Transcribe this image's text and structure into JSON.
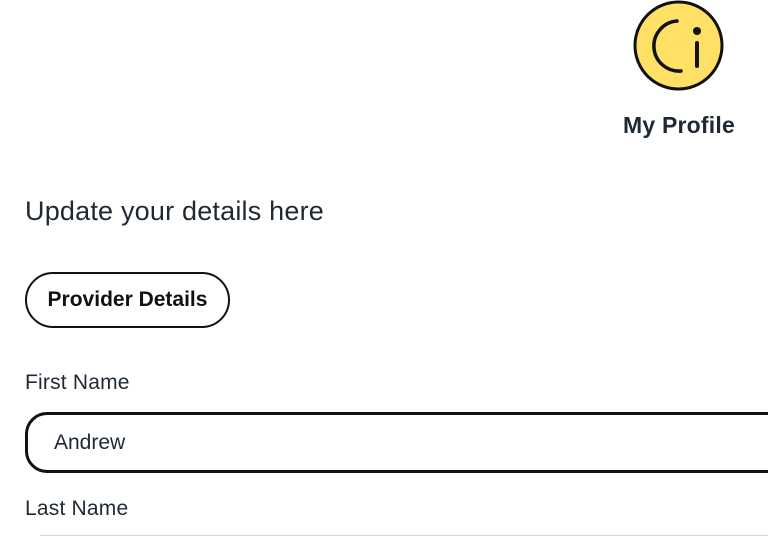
{
  "profile": {
    "label": "My Profile",
    "avatar_icon": "smiley-face-icon",
    "avatar_color": "#FFE066"
  },
  "form": {
    "heading": "Update your details here",
    "section_button_label": "Provider Details",
    "first_name": {
      "label": "First Name",
      "value": "Andrew"
    },
    "last_name": {
      "label": "Last Name"
    }
  }
}
